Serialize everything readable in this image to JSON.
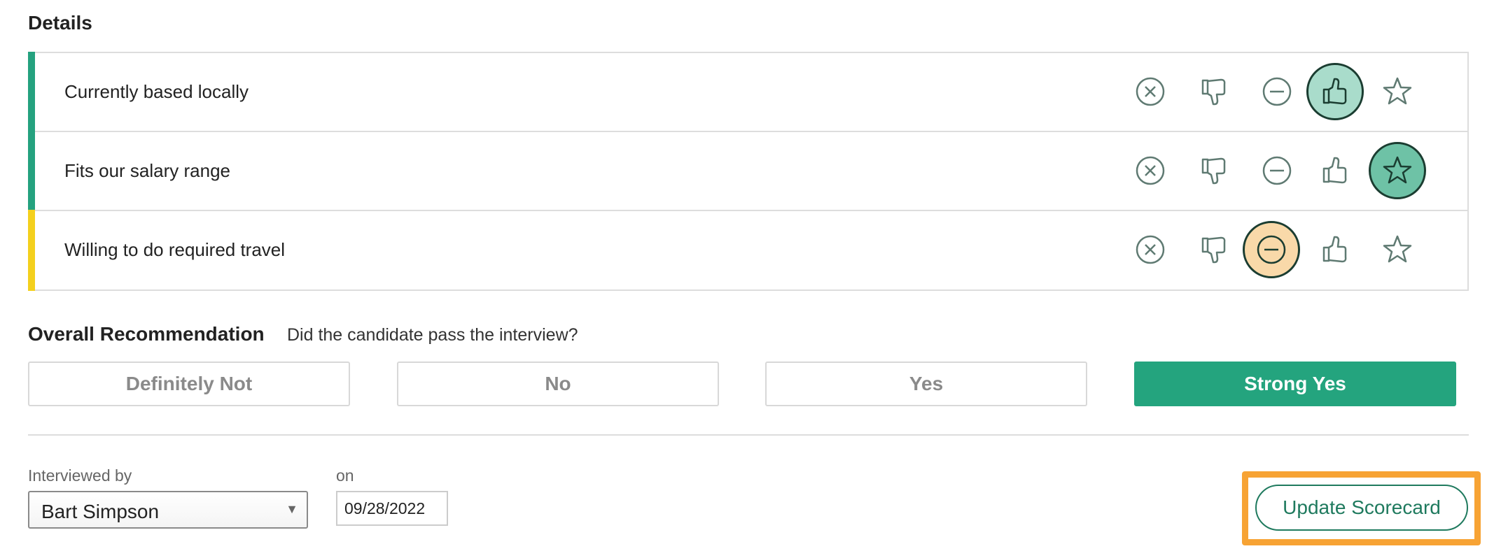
{
  "details": {
    "title": "Details",
    "rows": [
      {
        "label": "Currently based locally",
        "rating": "yes",
        "bar_color": "#25a27f"
      },
      {
        "label": "Fits our salary range",
        "rating": "strong-yes",
        "bar_color": "#25a27f"
      },
      {
        "label": "Willing to do required travel",
        "rating": "mixed",
        "bar_color": "#f4d01d"
      }
    ],
    "rating_options": [
      "definitely-not-icon",
      "thumbs-down-icon",
      "minus-circle-icon",
      "thumbs-up-icon",
      "star-icon"
    ]
  },
  "recommendation": {
    "title": "Overall Recommendation",
    "question": "Did the candidate pass the interview?",
    "options": [
      "Definitely Not",
      "No",
      "Yes",
      "Strong Yes"
    ],
    "selected": "Strong Yes",
    "accent": "#24a47e"
  },
  "footer": {
    "interviewed_by_label": "Interviewed by",
    "interviewer": "Bart Simpson",
    "on_label": "on",
    "date": "09/28/2022",
    "update_button": "Update Scorecard",
    "highlight_color": "#f7a334"
  }
}
